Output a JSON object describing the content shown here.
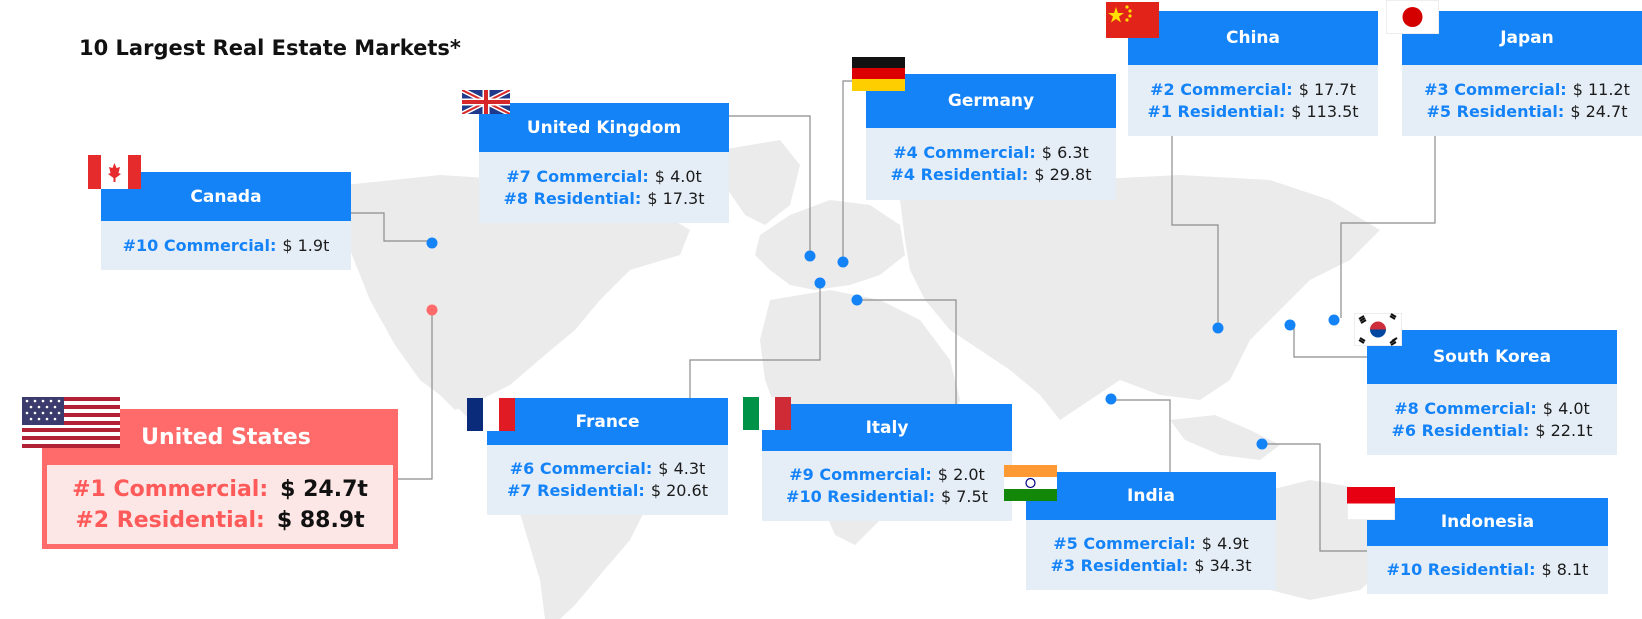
{
  "title": "10 Largest Real Estate Markets*",
  "colors": {
    "card_header": "#1583f8",
    "card_body": "#e5eef7",
    "label_blue": "#1583f8",
    "highlight": "#ff6b6b",
    "highlight_body": "#fde6e6",
    "highlight_label": "#ff5a5a",
    "map_land": "#ebebeb",
    "connector": "#8c8c8c",
    "dot": "#1583f8"
  },
  "markets": {
    "us": {
      "name": "United States",
      "stats": [
        {
          "label": "#1 Commercial:",
          "value": "$ 24.7t"
        },
        {
          "label": "#2 Residential:",
          "value": "$ 88.9t"
        }
      ]
    },
    "canada": {
      "name": "Canada",
      "stats": [
        {
          "label": "#10 Commercial:",
          "value": "$ 1.9t"
        }
      ]
    },
    "uk": {
      "name": "United Kingdom",
      "stats": [
        {
          "label": "#7 Commercial:",
          "value": "$ 4.0t"
        },
        {
          "label": "#8 Residential:",
          "value": "$ 17.3t"
        }
      ]
    },
    "germany": {
      "name": "Germany",
      "stats": [
        {
          "label": "#4 Commercial:",
          "value": "$ 6.3t"
        },
        {
          "label": "#4 Residential:",
          "value": "$ 29.8t"
        }
      ]
    },
    "china": {
      "name": "China",
      "stats": [
        {
          "label": "#2 Commercial:",
          "value": "$ 17.7t"
        },
        {
          "label": "#1 Residential:",
          "value": "$ 113.5t"
        }
      ]
    },
    "japan": {
      "name": "Japan",
      "stats": [
        {
          "label": "#3 Commercial:",
          "value": "$ 11.2t"
        },
        {
          "label": "#5 Residential:",
          "value": "$ 24.7t"
        }
      ]
    },
    "korea": {
      "name": "South Korea",
      "stats": [
        {
          "label": "#8 Commercial:",
          "value": "$ 4.0t"
        },
        {
          "label": "#6 Residential:",
          "value": "$ 22.1t"
        }
      ]
    },
    "france": {
      "name": "France",
      "stats": [
        {
          "label": "#6 Commercial:",
          "value": "$ 4.3t"
        },
        {
          "label": "#7 Residential:",
          "value": "$ 20.6t"
        }
      ]
    },
    "italy": {
      "name": "Italy",
      "stats": [
        {
          "label": "#9 Commercial:",
          "value": "$ 2.0t"
        },
        {
          "label": "#10 Residential:",
          "value": "$ 7.5t"
        }
      ]
    },
    "india": {
      "name": "India",
      "stats": [
        {
          "label": "#5 Commercial:",
          "value": "$ 4.9t"
        },
        {
          "label": "#3 Residential:",
          "value": "$ 34.3t"
        }
      ]
    },
    "indonesia": {
      "name": "Indonesia",
      "stats": [
        {
          "label": "#10 Residential:",
          "value": "$ 8.1t"
        }
      ]
    }
  }
}
